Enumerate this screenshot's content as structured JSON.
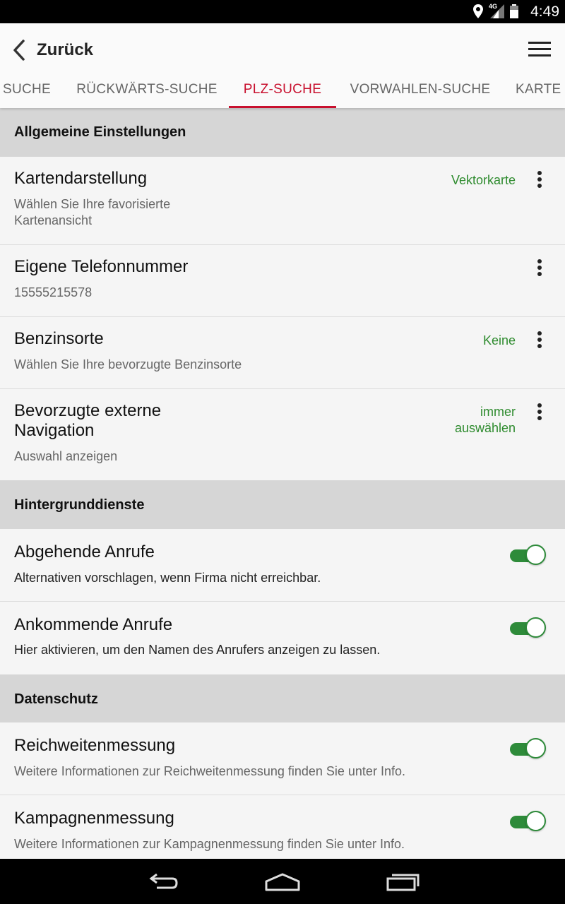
{
  "status_bar": {
    "time": "4:49",
    "network": "4G",
    "icons": [
      "location-icon",
      "signal-icon",
      "battery-icon"
    ]
  },
  "header": {
    "back_label": "Zurück",
    "menu_icon": "hamburger-menu-icon"
  },
  "tabs": [
    {
      "label": "SUCHE",
      "active": false
    },
    {
      "label": "RÜCKWÄRTS-SUCHE",
      "active": false
    },
    {
      "label": "PLZ-SUCHE",
      "active": true
    },
    {
      "label": "VORWAHLEN-SUCHE",
      "active": false
    },
    {
      "label": "KARTE",
      "active": false
    }
  ],
  "sections": {
    "general": {
      "header": "Allgemeine Einstellungen",
      "items": [
        {
          "title": "Kartendarstellung",
          "subtitle": "Wählen Sie Ihre favorisierte Kartenansicht",
          "value": "Vektorkarte"
        },
        {
          "title": "Eigene Telefonnummer",
          "subtitle": "15555215578",
          "value": ""
        },
        {
          "title": "Benzinsorte",
          "subtitle": "Wählen Sie Ihre bevorzugte Benzinsorte",
          "value": "Keine"
        },
        {
          "title": "Bevorzugte externe Navigation",
          "subtitle": "Auswahl anzeigen",
          "value": "immer auswählen"
        }
      ]
    },
    "background": {
      "header": "Hintergrunddienste",
      "items": [
        {
          "title": "Abgehende Anrufe",
          "subtitle": "Alternativen vorschlagen, wenn Firma nicht erreichbar.",
          "enabled": true
        },
        {
          "title": "Ankommende Anrufe",
          "subtitle": "Hier aktivieren, um den Namen des Anrufers anzeigen zu lassen.",
          "enabled": true
        }
      ]
    },
    "privacy": {
      "header": "Datenschutz",
      "items": [
        {
          "title": "Reichweitenmessung",
          "subtitle": "Weitere Informationen zur Reichweitenmessung finden Sie unter Info.",
          "enabled": true
        },
        {
          "title": "Kampagnenmessung",
          "subtitle": "Weitere Informationen zur Kampagnenmessung finden Sie unter Info.",
          "enabled": true
        }
      ]
    }
  },
  "colors": {
    "accent": "#c8102e",
    "value_green": "#2e8b2e",
    "toggle_on": "#2e8b3a",
    "section_bg": "#d6d6d6"
  },
  "nav_bar": {
    "icons": [
      "back-nav-icon",
      "home-nav-icon",
      "recents-nav-icon"
    ]
  }
}
